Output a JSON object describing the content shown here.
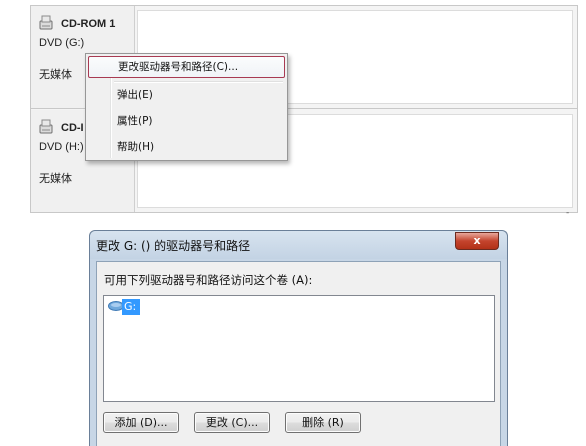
{
  "disks": [
    {
      "name": "CD-ROM 1",
      "type": "DVD (G:)",
      "media": "无媒体"
    },
    {
      "name": "CD-I",
      "type": "DVD (H:)",
      "media": "无媒体"
    }
  ],
  "context_menu": {
    "items": [
      "更改驱动器号和路径(C)...",
      "弹出(E)",
      "属性(P)",
      "帮助(H)"
    ]
  },
  "corner_mark": "-",
  "dialog": {
    "title": "更改 G: () 的驱动器号和路径",
    "close_label": "x",
    "prompt": "可用下列驱动器号和路径访问这个卷 (A):",
    "list_items": [
      "G:"
    ],
    "buttons": {
      "add": "添加 (D)...",
      "change": "更改 (C)...",
      "delete": "删除 (R)"
    }
  },
  "colors": {
    "selection": "#3399ff",
    "menu_highlight_border": "#a83a52",
    "close_button": "#c4442d"
  }
}
